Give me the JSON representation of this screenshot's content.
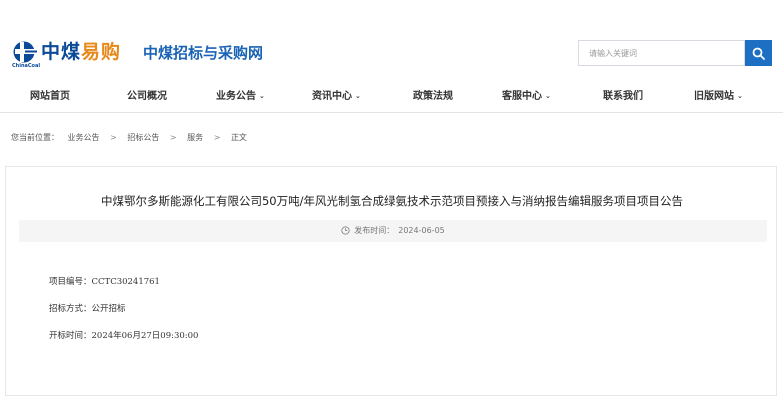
{
  "header": {
    "brand_main": "中煤",
    "brand_accent": "易购",
    "brand_sub": "ChinaCoal",
    "site_name": "中煤招标与采购网",
    "search": {
      "placeholder": "请输入关键词"
    },
    "colors": {
      "brand_blue": "#0b4a96",
      "brand_orange": "#e8891a",
      "accent": "#1d6fc4"
    }
  },
  "nav": {
    "items": [
      {
        "label": "网站首页",
        "has_dropdown": false
      },
      {
        "label": "公司概况",
        "has_dropdown": false
      },
      {
        "label": "业务公告",
        "has_dropdown": true
      },
      {
        "label": "资讯中心",
        "has_dropdown": true
      },
      {
        "label": "政策法规",
        "has_dropdown": false
      },
      {
        "label": "客服中心",
        "has_dropdown": true
      },
      {
        "label": "联系我们",
        "has_dropdown": false
      },
      {
        "label": "旧版网站",
        "has_dropdown": true
      }
    ],
    "dropdown_icon": "chevron-down-icon"
  },
  "breadcrumb": {
    "prefix": "您当前位置：",
    "items": [
      "业务公告",
      "招标公告",
      "服务",
      "正文"
    ],
    "separator": ">"
  },
  "article": {
    "title": "中煤鄂尔多斯能源化工有限公司50万吨/年风光制氢合成绿氨技术示范项目预接入与消纳报告编辑服务项目项目公告",
    "published_label": "发布时间：",
    "published_date": "2024-06-05",
    "fields": [
      {
        "label": "项目编号：",
        "value": "CCTC30241761"
      },
      {
        "label": "招标方式：",
        "value": "公开招标"
      },
      {
        "label": "开标时间：",
        "value": "2024年06月27日09:30:00"
      }
    ]
  }
}
